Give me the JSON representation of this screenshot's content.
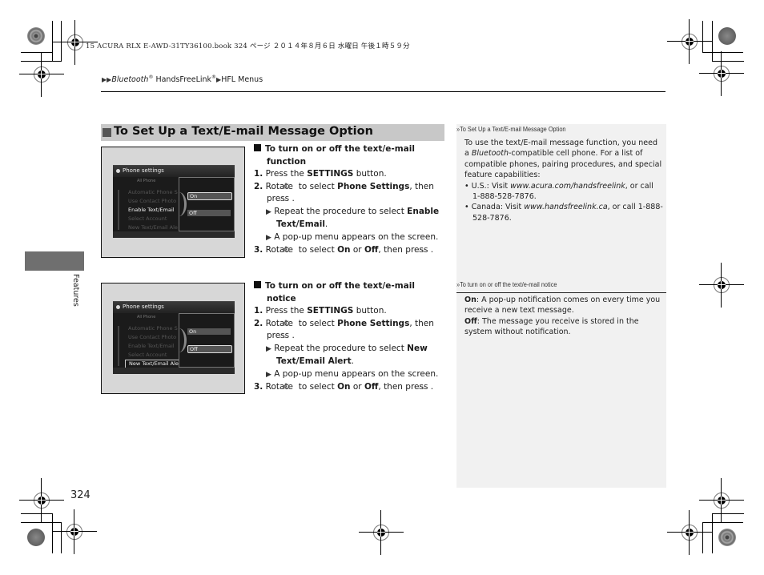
{
  "print_header": "15 ACURA RLX E-AWD-31TY36100.book  324 ページ  ２０１４年８月６日  水曜日  午後１時５９分",
  "breadcrumb": {
    "arrow": "▶▶",
    "part1": "Bluetooth",
    "reg1": "®",
    "part2": " HandsFreeLink",
    "reg2": "®",
    "arrow2": "▶",
    "part3": "HFL Menus"
  },
  "side_tab": {
    "label": "Features"
  },
  "section": {
    "title": "To Set Up a Text/E-mail Message Option"
  },
  "procedures": [
    {
      "heading": "To turn on or off the text/e-mail function",
      "screen": {
        "title": "Phone settings",
        "tabs": "All          Phone",
        "items": [
          "Automatic Phone S",
          "Use Contact Photo",
          "Enable Text/Email",
          "Select Account",
          "New Text/Email Ale"
        ],
        "selected_index": 2,
        "popup_options": [
          "On",
          "Off"
        ],
        "popup_selected": "On"
      },
      "steps": [
        {
          "num": "1.",
          "pre": "Press the ",
          "bold": "SETTINGS",
          "post": " button."
        },
        {
          "num": "2.",
          "pre": "Rotate ",
          "mid": " to select ",
          "bold": "Phone Settings",
          "post": ", then press ",
          "end": "."
        },
        {
          "note": true,
          "pre": "Repeat the procedure to select ",
          "bold": "Enable Text/Email",
          "post": "."
        },
        {
          "note": true,
          "pre": "A pop-up menu appears on the screen."
        },
        {
          "num": "3.",
          "pre": "Rotate ",
          "mid": " to select ",
          "bold": "On",
          "or": " or ",
          "bold2": "Off",
          "post": ", then press ",
          "end": "."
        }
      ]
    },
    {
      "heading": "To turn on or off the text/e-mail notice",
      "screen": {
        "title": "Phone settings",
        "tabs": "All          Phone",
        "items": [
          "Automatic Phone S",
          "Use Contact Photo",
          "Enable Text/Email",
          "Select Account",
          "New Text/Email Ale"
        ],
        "selected_index": 4,
        "popup_options": [
          "On",
          "Off"
        ],
        "popup_selected": "Off"
      },
      "steps": [
        {
          "num": "1.",
          "pre": "Press the ",
          "bold": "SETTINGS",
          "post": " button."
        },
        {
          "num": "2.",
          "pre": "Rotate ",
          "mid": " to select ",
          "bold": "Phone Settings",
          "post": ", then press ",
          "end": "."
        },
        {
          "note": true,
          "pre": "Repeat the procedure to select ",
          "bold": "New Text/Email Alert",
          "post": "."
        },
        {
          "note": true,
          "pre": "A pop-up menu appears on the screen."
        },
        {
          "num": "3.",
          "pre": "Rotate ",
          "mid": " to select ",
          "bold": "On",
          "or": " or ",
          "bold2": "Off",
          "post": ", then press ",
          "end": "."
        }
      ]
    }
  ],
  "icons": {
    "rotate": "interface-dial-rotate-icon",
    "press": "interface-dial-press-icon",
    "note_arrow": "▶",
    "ref": "»"
  },
  "side_notes": [
    {
      "heading": "To Set Up a Text/E-mail Message Option",
      "body_pre": "To use the text/E-mail message function, you need a ",
      "body_italic": "Bluetooth",
      "body_post": "-compatible cell phone. For a list of compatible phones, pairing procedures, and special feature capabilities:",
      "bullets": [
        {
          "pre": "U.S.: Visit ",
          "url": "www.acura.com/handsfreelink",
          "post": ", or call 1-888-528-7876."
        },
        {
          "pre": "Canada: Visit ",
          "url": "www.handsfreelink.ca",
          "post": ", or call 1-888-528-7876."
        }
      ]
    },
    {
      "heading": "To turn on or off the text/e-mail notice",
      "items": [
        {
          "term": "On",
          "text": ": A pop-up notification comes on every time you receive a new text message."
        },
        {
          "term": "Off",
          "text": ": The message you receive is stored in the system without notification."
        }
      ]
    }
  ],
  "page_number": "324",
  "colors": {
    "section_bar": "#c8c8c8",
    "side_tab": "#6f6f6f",
    "side_panel": "#f1f1f1"
  }
}
